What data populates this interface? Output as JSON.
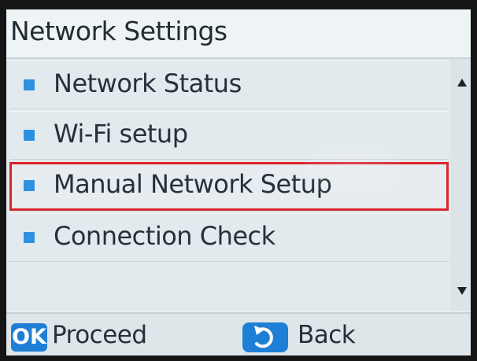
{
  "screen": {
    "title": "Network Settings"
  },
  "menu": {
    "items": [
      {
        "label": "Network Status",
        "selected": false
      },
      {
        "label": "Wi-Fi setup",
        "selected": false
      },
      {
        "label": "Manual Network Setup",
        "selected": true
      },
      {
        "label": "Connection Check",
        "selected": false
      }
    ]
  },
  "scrollbar": {
    "up_icon": "triangle-up-icon",
    "down_icon": "triangle-down-icon"
  },
  "footer": {
    "ok_badge": "OK",
    "proceed_label": "Proceed",
    "back_icon": "return-arrow-icon",
    "back_label": "Back"
  },
  "colors": {
    "accent_blue": "#1f7fd6",
    "bullet_blue": "#2f8fe0",
    "highlight_red": "#d8262c",
    "screen_bg": "#e9eef1",
    "text_dark": "#25303a"
  }
}
